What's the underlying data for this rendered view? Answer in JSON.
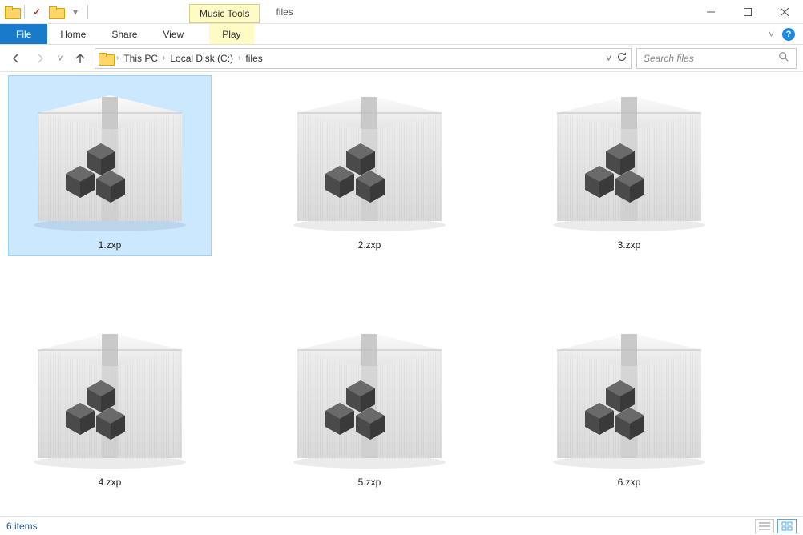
{
  "window": {
    "title": "files"
  },
  "context_tab": {
    "title": "Music Tools",
    "tab": "Play"
  },
  "ribbon": {
    "file": "File",
    "home": "Home",
    "share": "Share",
    "view": "View"
  },
  "breadcrumb": [
    "This PC",
    "Local Disk (C:)",
    "files"
  ],
  "search": {
    "placeholder": "Search files"
  },
  "files": [
    {
      "name": "1.zxp",
      "selected": true
    },
    {
      "name": "2.zxp",
      "selected": false
    },
    {
      "name": "3.zxp",
      "selected": false
    },
    {
      "name": "4.zxp",
      "selected": false
    },
    {
      "name": "5.zxp",
      "selected": false
    },
    {
      "name": "6.zxp",
      "selected": false
    }
  ],
  "status": {
    "count_text": "6 items"
  }
}
